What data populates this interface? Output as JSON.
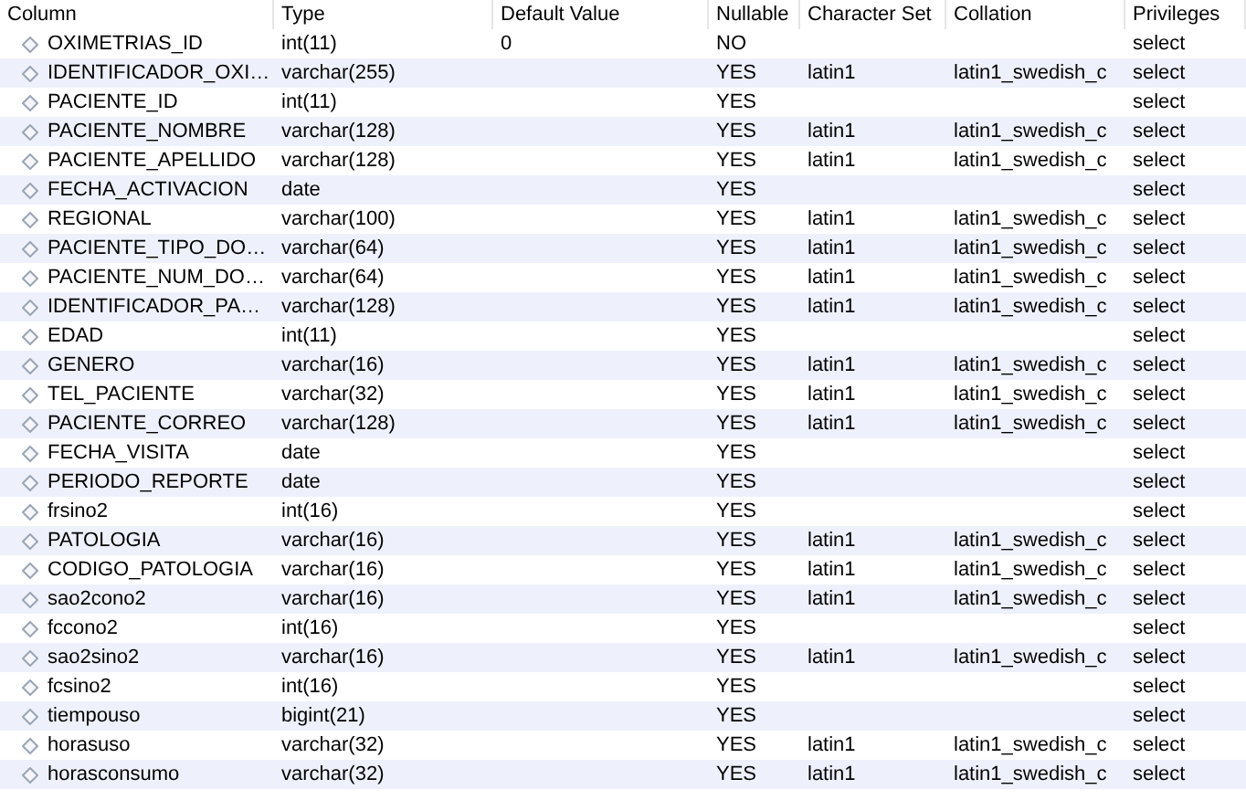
{
  "columns": [
    "Column",
    "Type",
    "Default Value",
    "Nullable",
    "Character Set",
    "Collation",
    "Privileges"
  ],
  "rows": [
    {
      "column": "OXIMETRIAS_ID",
      "type": "int(11)",
      "default": "0",
      "nullable": "NO",
      "charset": "",
      "collation": "",
      "privileges": "select"
    },
    {
      "column": "IDENTIFICADOR_OXI…",
      "type": "varchar(255)",
      "nullable": "YES",
      "charset": "latin1",
      "collation": "latin1_swedish_c",
      "privileges": "select"
    },
    {
      "column": "PACIENTE_ID",
      "type": "int(11)",
      "nullable": "YES",
      "privileges": "select"
    },
    {
      "column": "PACIENTE_NOMBRE",
      "type": "varchar(128)",
      "nullable": "YES",
      "charset": "latin1",
      "collation": "latin1_swedish_c",
      "privileges": "select"
    },
    {
      "column": "PACIENTE_APELLIDO",
      "type": "varchar(128)",
      "nullable": "YES",
      "charset": "latin1",
      "collation": "latin1_swedish_c",
      "privileges": "select"
    },
    {
      "column": "FECHA_ACTIVACION",
      "type": "date",
      "nullable": "YES",
      "privileges": "select"
    },
    {
      "column": "REGIONAL",
      "type": "varchar(100)",
      "nullable": "YES",
      "charset": "latin1",
      "collation": "latin1_swedish_c",
      "privileges": "select"
    },
    {
      "column": "PACIENTE_TIPO_DO…",
      "type": "varchar(64)",
      "nullable": "YES",
      "charset": "latin1",
      "collation": "latin1_swedish_c",
      "privileges": "select"
    },
    {
      "column": "PACIENTE_NUM_DO…",
      "type": "varchar(64)",
      "nullable": "YES",
      "charset": "latin1",
      "collation": "latin1_swedish_c",
      "privileges": "select"
    },
    {
      "column": "IDENTIFICADOR_PA…",
      "type": "varchar(128)",
      "nullable": "YES",
      "charset": "latin1",
      "collation": "latin1_swedish_c",
      "privileges": "select"
    },
    {
      "column": "EDAD",
      "type": "int(11)",
      "nullable": "YES",
      "privileges": "select"
    },
    {
      "column": "GENERO",
      "type": "varchar(16)",
      "nullable": "YES",
      "charset": "latin1",
      "collation": "latin1_swedish_c",
      "privileges": "select"
    },
    {
      "column": "TEL_PACIENTE",
      "type": "varchar(32)",
      "nullable": "YES",
      "charset": "latin1",
      "collation": "latin1_swedish_c",
      "privileges": "select"
    },
    {
      "column": "PACIENTE_CORREO",
      "type": "varchar(128)",
      "nullable": "YES",
      "charset": "latin1",
      "collation": "latin1_swedish_c",
      "privileges": "select"
    },
    {
      "column": "FECHA_VISITA",
      "type": "date",
      "nullable": "YES",
      "privileges": "select"
    },
    {
      "column": "PERIODO_REPORTE",
      "type": "date",
      "nullable": "YES",
      "privileges": "select"
    },
    {
      "column": "frsino2",
      "type": "int(16)",
      "nullable": "YES",
      "privileges": "select"
    },
    {
      "column": "PATOLOGIA",
      "type": "varchar(16)",
      "nullable": "YES",
      "charset": "latin1",
      "collation": "latin1_swedish_c",
      "privileges": "select"
    },
    {
      "column": "CODIGO_PATOLOGIA",
      "type": "varchar(16)",
      "nullable": "YES",
      "charset": "latin1",
      "collation": "latin1_swedish_c",
      "privileges": "select"
    },
    {
      "column": "sao2cono2",
      "type": "varchar(16)",
      "nullable": "YES",
      "charset": "latin1",
      "collation": "latin1_swedish_c",
      "privileges": "select"
    },
    {
      "column": "fccono2",
      "type": "int(16)",
      "nullable": "YES",
      "privileges": "select"
    },
    {
      "column": "sao2sino2",
      "type": "varchar(16)",
      "nullable": "YES",
      "charset": "latin1",
      "collation": "latin1_swedish_c",
      "privileges": "select"
    },
    {
      "column": "fcsino2",
      "type": "int(16)",
      "nullable": "YES",
      "privileges": "select"
    },
    {
      "column": "tiempouso",
      "type": "bigint(21)",
      "nullable": "YES",
      "privileges": "select"
    },
    {
      "column": "horasuso",
      "type": "varchar(32)",
      "nullable": "YES",
      "charset": "latin1",
      "collation": "latin1_swedish_c",
      "privileges": "select"
    },
    {
      "column": "horasconsumo",
      "type": "varchar(32)",
      "nullable": "YES",
      "charset": "latin1",
      "collation": "latin1_swedish_c",
      "privileges": "select"
    }
  ]
}
